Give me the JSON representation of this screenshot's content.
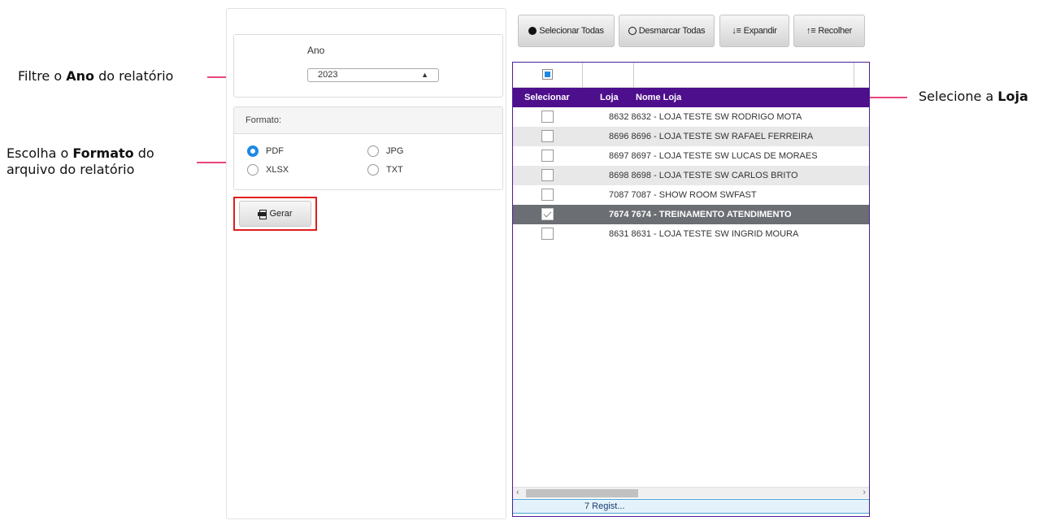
{
  "annotations": {
    "ano": {
      "pre": "Filtre o ",
      "bold": "Ano",
      "post": " do relatório"
    },
    "formato": {
      "line1_pre": "Escolha o ",
      "line1_bold": "Formato",
      "line1_post": " do",
      "line2": "arquivo do relatório"
    },
    "loja": {
      "pre": "Selecione a ",
      "bold": "Loja"
    },
    "line_color": "#e8467c"
  },
  "filters": {
    "ano_label": "Ano",
    "ano_value": "2023",
    "formato_label": "Formato:",
    "formats": [
      {
        "label": "PDF",
        "checked": true
      },
      {
        "label": "JPG",
        "checked": false
      },
      {
        "label": "XLSX",
        "checked": false
      },
      {
        "label": "TXT",
        "checked": false
      }
    ],
    "gerar_label": "Gerar",
    "gerar_icon": "printer-icon"
  },
  "toolbar": {
    "select_all": "Selecionar Todas",
    "deselect_all": "Desmarcar Todas",
    "expand": "Expandir",
    "collapse": "Recolher"
  },
  "grid": {
    "columns": [
      "Selecionar",
      "Loja",
      "Nome Loja"
    ],
    "header_color": "#4d0f8c",
    "rows": [
      {
        "text": "8632 8632 - LOJA TESTE SW RODRIGO MOTA",
        "checked": false
      },
      {
        "text": "8696 8696 - LOJA TESTE SW RAFAEL FERREIRA",
        "checked": false
      },
      {
        "text": "8697 8697 - LOJA TESTE SW LUCAS DE MORAES",
        "checked": false
      },
      {
        "text": "8698 8698 - LOJA TESTE SW CARLOS BRITO",
        "checked": false
      },
      {
        "text": "7087 7087 - SHOW ROOM SWFAST",
        "checked": false
      },
      {
        "text": "7674 7674 - TREINAMENTO ATENDIMENTO",
        "checked": true
      },
      {
        "text": "8631 8631 - LOJA TESTE SW INGRID MOURA",
        "checked": false
      }
    ],
    "footer": "7 Regist..."
  }
}
